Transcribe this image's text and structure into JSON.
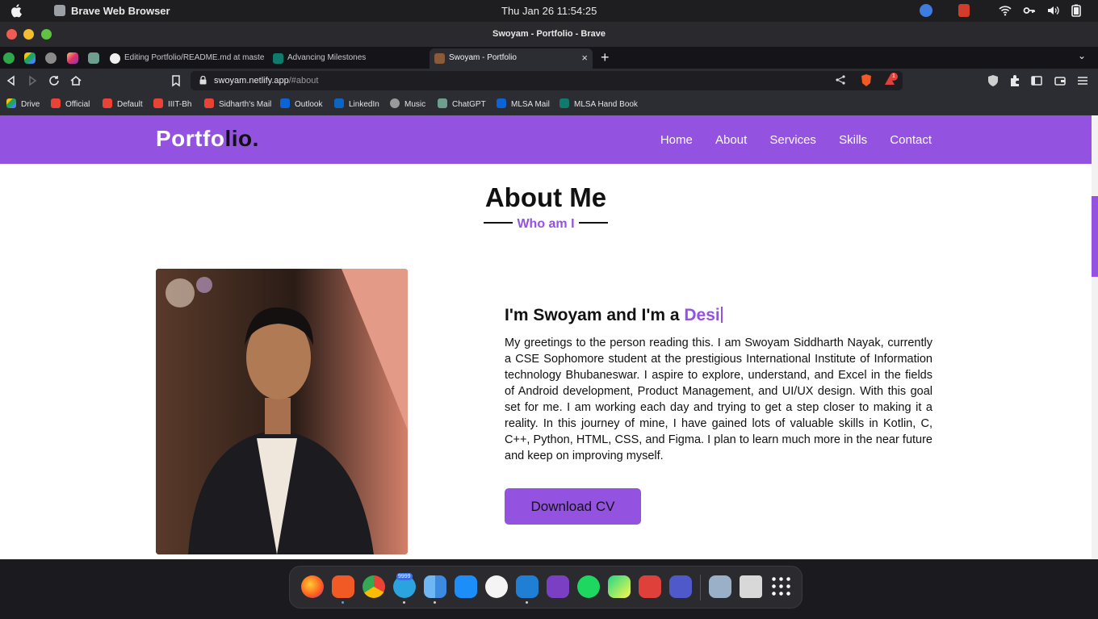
{
  "menubar": {
    "app_name": "Brave Web Browser",
    "clock": "Thu Jan 26  11:54:25"
  },
  "window": {
    "title": "Swoyam - Portfolio - Brave"
  },
  "tabs": [
    {
      "label": "Editing Portfolio/README.md at master"
    },
    {
      "label": "Advancing Milestones"
    },
    {
      "label": "Swoyam - Portfolio"
    }
  ],
  "toolbar": {
    "url_host": "swoyam.netlify.app",
    "url_path": "/#about",
    "rewards_badge": "1"
  },
  "bookmarks": [
    "Drive",
    "Official",
    "Default",
    "IIIT-Bh",
    "Sidharth's Mail",
    "Outlook",
    "LinkedIn",
    "Music",
    "ChatGPT",
    "MLSA Mail",
    "MLSA Hand Book"
  ],
  "site": {
    "logo_a": "Portfo",
    "logo_b": "lio.",
    "nav": [
      "Home",
      "About",
      "Services",
      "Skills",
      "Contact"
    ],
    "section_title": "About Me",
    "section_subtitle": "Who am I",
    "intro_prefix": "I'm Swoyam and I'm a ",
    "intro_role": "Desi",
    "bio": "My greetings to the person reading this. I am Swoyam Siddharth Nayak, currently a CSE Sophomore student at the prestigious International Institute of Information technology Bhubaneswar. I aspire to explore, understand, and Excel in the fields of Android development, Product Management, and UI/UX design. With this goal set for me. I am working each day and trying to get a step closer to making it a reality. In this journey of mine, I have gained lots of valuable skills in Kotlin, C, C++, Python, HTML, CSS, and Figma. I plan to learn much more in the near future and keep on improving myself.",
    "cv_button": "Download CV"
  },
  "dock": {
    "apps": [
      "firefox-icon",
      "brave-icon",
      "chrome-icon",
      "telegram-icon",
      "finder-icon",
      "app-store-icon",
      "wps-icon",
      "vscode-icon",
      "github-desktop-icon",
      "spotify-icon",
      "pycharm-icon",
      "anydesk-icon",
      "teams-icon"
    ],
    "telegram_badge": "9999"
  },
  "colors": {
    "accent": "#9452e1",
    "page_bg": "#ffffff",
    "chrome_bg": "#2c2c33"
  }
}
